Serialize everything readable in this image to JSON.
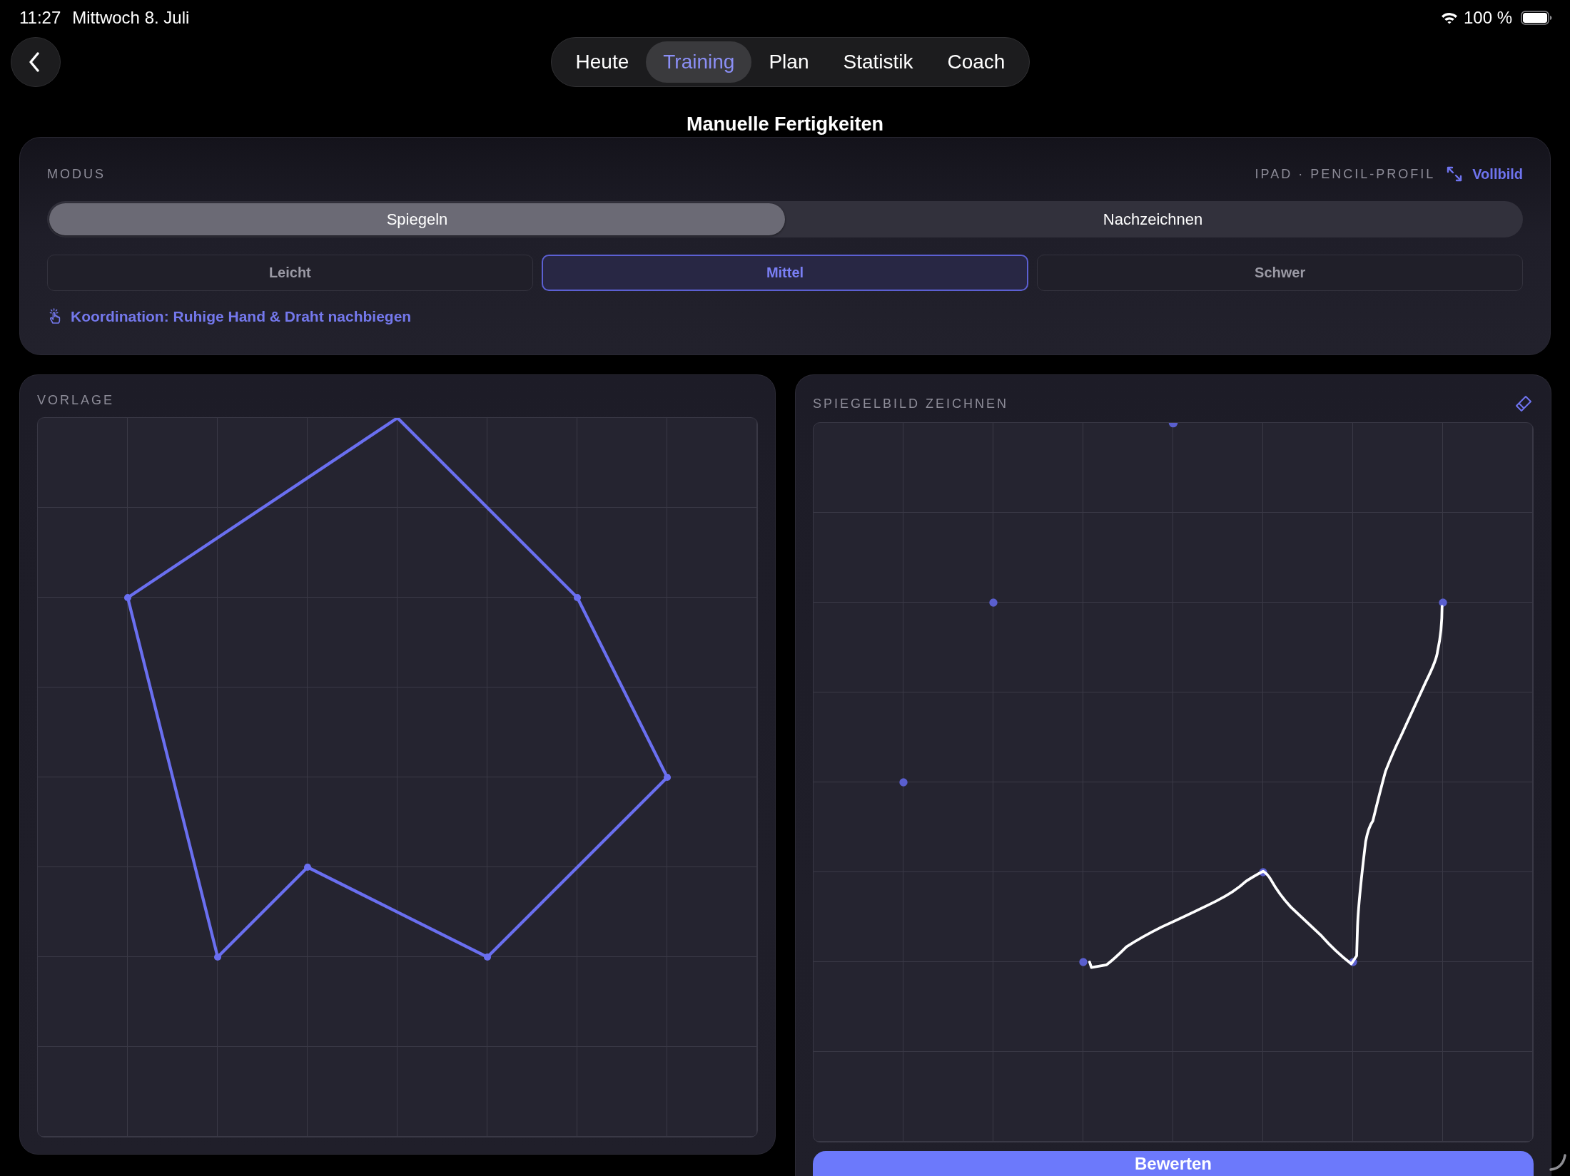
{
  "status_bar": {
    "time": "11:27",
    "date": "Mittwoch 8. Juli",
    "battery": "100 %"
  },
  "nav": {
    "tabs": [
      {
        "label": "Heute",
        "selected": false
      },
      {
        "label": "Training",
        "selected": true
      },
      {
        "label": "Plan",
        "selected": false
      },
      {
        "label": "Statistik",
        "selected": false
      },
      {
        "label": "Coach",
        "selected": false
      }
    ]
  },
  "page_title": "Manuelle Fertigkeiten",
  "mode_panel": {
    "label": "MODUS",
    "device_profile": "IPAD · PENCIL-PROFIL",
    "fullscreen_link": "Vollbild",
    "modes": [
      {
        "label": "Spiegeln",
        "selected": true
      },
      {
        "label": "Nachzeichnen",
        "selected": false
      }
    ],
    "difficulties": [
      {
        "label": "Leicht",
        "selected": false
      },
      {
        "label": "Mittel",
        "selected": true
      },
      {
        "label": "Schwer",
        "selected": false
      }
    ],
    "skill_hint": "Koordination: Ruhige Hand & Draht nachbiegen"
  },
  "template_panel": {
    "title": "VORLAGE"
  },
  "drawing_panel": {
    "title": "SPIEGELBILD ZEICHNEN",
    "submit_button": "Bewerten"
  }
}
